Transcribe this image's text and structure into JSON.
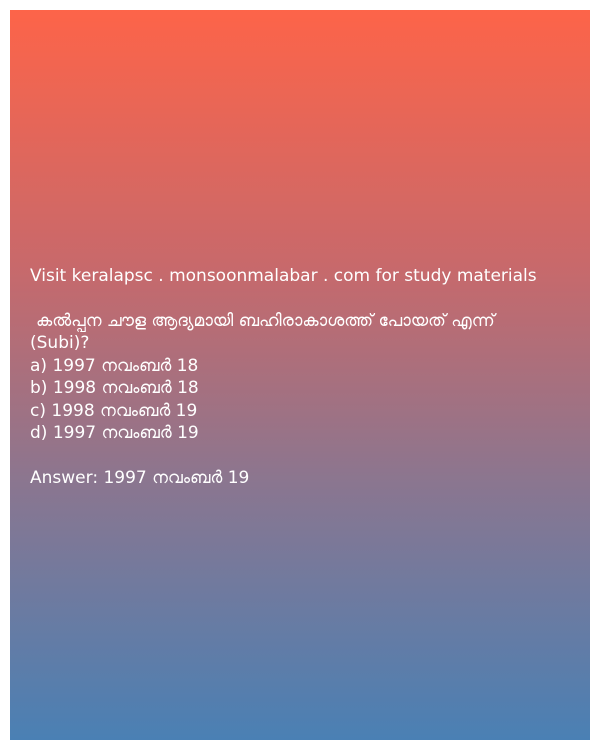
{
  "header": {
    "visit_text": "Visit keralapsc . monsoonmalabar . com for study materials"
  },
  "question": {
    "text": "കൽപ്പന ചൗള ആദ്യമായി ബഹിരാകാശത്ത് പോയത് എന്ന്",
    "source": "(Subi)?"
  },
  "options": [
    "a) 1997 നവംബർ 18",
    "b) 1998 നവംബർ 18",
    "c) 1998 നവംബർ 19",
    "d) 1997 നവംബർ 19"
  ],
  "answer": {
    "text": "Answer: 1997 നവംബർ 19"
  },
  "colors": {
    "gradient_top": "#fd6449",
    "gradient_bottom": "#4a80b4",
    "text": "#ffffff"
  }
}
